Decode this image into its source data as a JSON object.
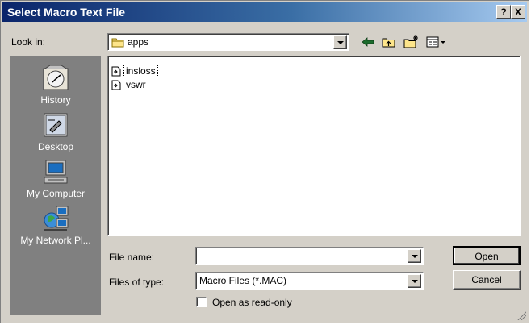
{
  "window": {
    "title": "Select Macro Text File",
    "help_btn": "?",
    "close_btn": "X"
  },
  "look_in": {
    "label": "Look in:",
    "value": "apps"
  },
  "places": [
    {
      "label": "History"
    },
    {
      "label": "Desktop"
    },
    {
      "label": "My Computer"
    },
    {
      "label": "My Network Pl..."
    }
  ],
  "files": [
    {
      "name": "insloss"
    },
    {
      "name": "vswr"
    }
  ],
  "file_name": {
    "label": "File name:",
    "value": ""
  },
  "file_type": {
    "label": "Files of type:",
    "value": "Macro Files (*.MAC)"
  },
  "readonly": {
    "label": "Open as read-only",
    "checked": false
  },
  "buttons": {
    "open": "Open",
    "cancel": "Cancel"
  },
  "colors": {
    "titlebar_start": "#0a246a",
    "titlebar_end": "#a6caf0",
    "face": "#d4d0c8",
    "places_bg": "#808080"
  }
}
